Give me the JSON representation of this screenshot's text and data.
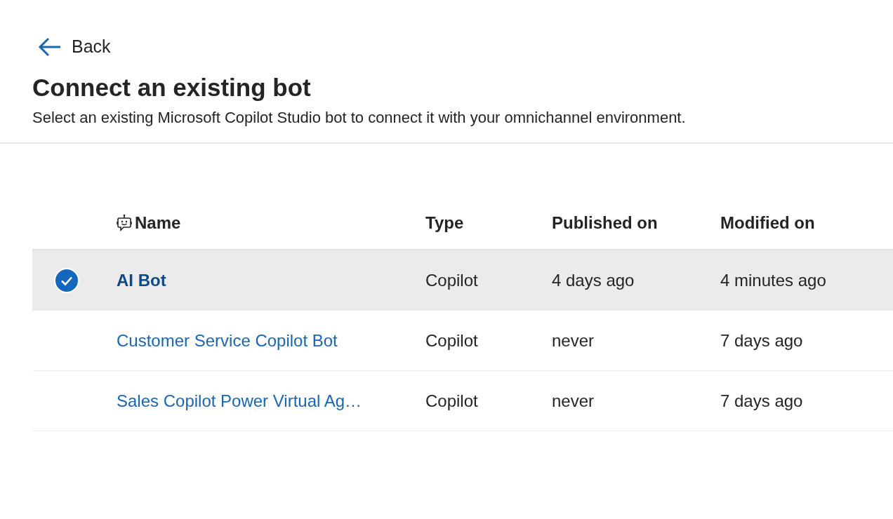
{
  "back": {
    "label": "Back"
  },
  "title": "Connect an existing bot",
  "subtitle": "Select an existing Microsoft Copilot Studio bot to connect it with your omnichannel environment.",
  "table": {
    "columns": [
      "Name",
      "Type",
      "Published on",
      "Modified on"
    ],
    "rows": [
      {
        "name": "AI Bot",
        "type": "Copilot",
        "published_on": "4 days ago",
        "modified_on": "4 minutes ago",
        "selected": true
      },
      {
        "name": "Customer Service Copilot Bot",
        "type": "Copilot",
        "published_on": "never",
        "modified_on": "7 days ago",
        "selected": false
      },
      {
        "name": "Sales Copilot Power Virtual Ag…",
        "type": "Copilot",
        "published_on": "never",
        "modified_on": "7 days ago",
        "selected": false
      }
    ]
  }
}
